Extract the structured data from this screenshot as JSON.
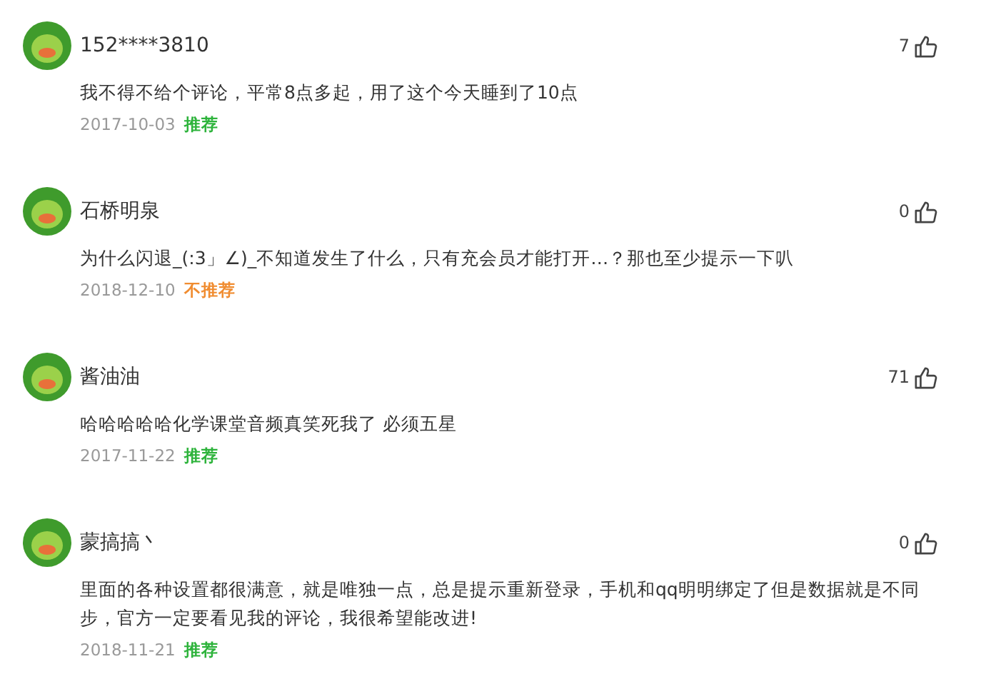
{
  "comments": [
    {
      "user": "152****3810",
      "likes": "7",
      "text": "我不得不给个评论，平常8点多起，用了这个今天睡到了10点",
      "date": "2017-10-03",
      "tag": "推荐",
      "recommended": true
    },
    {
      "user": "石桥明泉",
      "likes": "0",
      "text": "为什么闪退_(:3」∠)_不知道发生了什么，只有充会员才能打开…？那也至少提示一下叭",
      "date": "2018-12-10",
      "tag": "不推荐",
      "recommended": false
    },
    {
      "user": "酱油油",
      "likes": "71",
      "text": "哈哈哈哈哈化学课堂音频真笑死我了 必须五星",
      "date": "2017-11-22",
      "tag": "推荐",
      "recommended": true
    },
    {
      "user": "蒙搞搞丶",
      "likes": "0",
      "text": "里面的各种设置都很满意，就是唯独一点，总是提示重新登录，手机和qq明明绑定了但是数据就是不同步，官方一定要看见我的评论，我很希望能改进!",
      "date": "2018-11-21",
      "tag": "推荐",
      "recommended": true
    }
  ]
}
